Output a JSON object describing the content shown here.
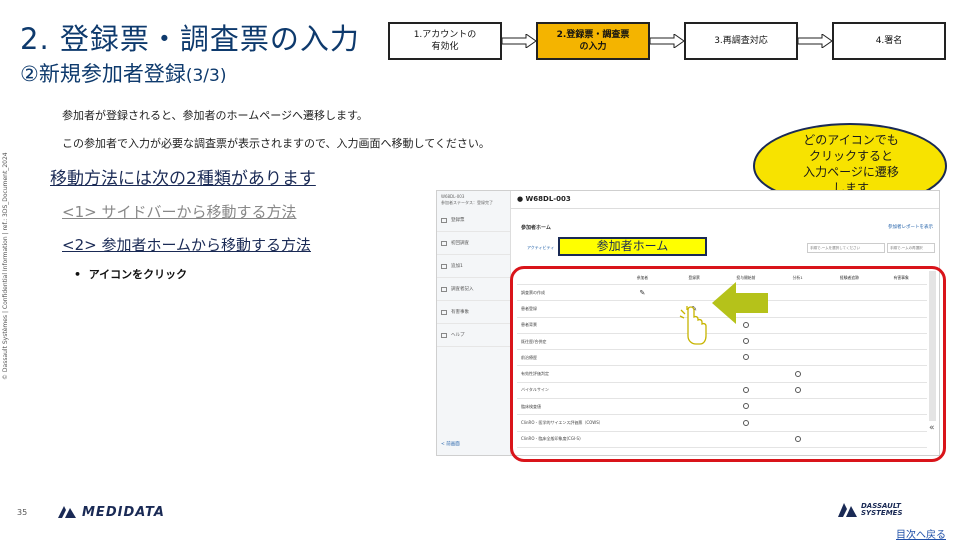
{
  "title": {
    "main": "2. 登録票・調査票の入力",
    "sub": "②新規参加者登録",
    "sub_page": "(3/3)"
  },
  "steps": [
    {
      "label": "1.アカウントの\n有効化",
      "active": false
    },
    {
      "label": "2.登録票・調査票\nの入力",
      "active": true
    },
    {
      "label": "3.再調査対応",
      "active": false
    },
    {
      "label": "4.署名",
      "active": false
    }
  ],
  "description": {
    "line1": "参加者が登録されると、参加者のホームページへ遷移します。",
    "line2": "この参加者で入力が必要な調査票が表示されますので、入力画面へ移動してください。"
  },
  "methods": {
    "heading": "移動方法には次の2種類があります",
    "method1": "<1> サイドバーから移動する方法",
    "method2": "<2> 参加者ホームから移動する方法",
    "bullet": "アイコンをクリック"
  },
  "callout": {
    "bubble_text": "どのアイコンでも\nクリックすると\n入力ページに遷移\nします",
    "home_label": "参加者ホーム"
  },
  "screenshot": {
    "study_id": "W68DL-003",
    "side_head": "W68DL-003",
    "side_head_sub": "参加者ステータス：登録完了",
    "side_items": [
      "登録票",
      "初回調査",
      "追加1",
      "調査者記入",
      "有害事象",
      "ヘルプ"
    ],
    "back_link": "< 前画面",
    "card_title": "参加者ホーム",
    "card_link": "参加者レポートを表示",
    "tab_label": "アクティビティ",
    "select_placeholder": "手順で-ームを選択してください",
    "select2": "手順で-ームの再選択",
    "columns": [
      "参加者",
      "登録票",
      "投与開始前",
      "分析1",
      "経験者追跡",
      "有害事象"
    ],
    "rows": [
      {
        "name": "調査票の作成",
        "marks": [
          "pencil",
          "",
          "",
          "",
          "",
          ""
        ]
      },
      {
        "name": "患者登録",
        "marks": [
          "",
          "pencil",
          "circle",
          "",
          "",
          ""
        ]
      },
      {
        "name": "患者背景",
        "marks": [
          "",
          "",
          "circle",
          "",
          "",
          ""
        ]
      },
      {
        "name": "既往歴/合併症",
        "marks": [
          "",
          "",
          "circle",
          "",
          "",
          ""
        ]
      },
      {
        "name": "前治療歴",
        "marks": [
          "",
          "",
          "circle",
          "",
          "",
          ""
        ]
      },
      {
        "name": "有効性評価判定",
        "marks": [
          "",
          "",
          "",
          "circle",
          "",
          ""
        ]
      },
      {
        "name": "バイタルサイン",
        "marks": [
          "",
          "",
          "circle",
          "circle",
          "",
          ""
        ]
      },
      {
        "name": "臨床検査値",
        "marks": [
          "",
          "",
          "circle",
          "",
          "",
          ""
        ]
      },
      {
        "name": "ClinRO - 医学的サイエンス評価票（COWS）",
        "marks": [
          "",
          "",
          "circle",
          "",
          "",
          ""
        ]
      },
      {
        "name": "ClinRO - 臨床全般印象度(CGI-S)",
        "marks": [
          "",
          "",
          "",
          "circle",
          "",
          ""
        ]
      }
    ]
  },
  "footer": {
    "page_number": "35",
    "medidata": "MEDIDATA",
    "dassault_line1": "DASSAULT",
    "dassault_line2": "SYSTEMES",
    "toc_link": "目次へ戻る",
    "vertical_note": "© Dassault Systèmes | Confidential Information | ref.: 3DS_Document_2024"
  },
  "colors": {
    "title": "#0e3a6d",
    "active_step": "#f4b400",
    "highlight": "#ffff00",
    "outline": "#d9141a",
    "arrow": "#b5c21a",
    "bubble": "#f7e300"
  }
}
